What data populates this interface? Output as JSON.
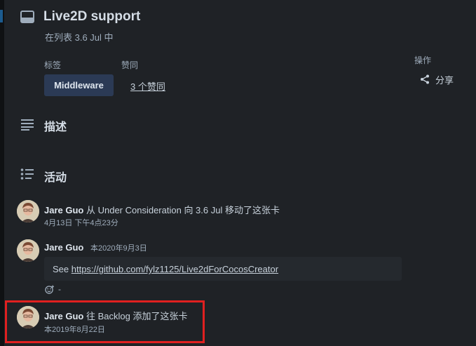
{
  "card": {
    "title": "Live2D support",
    "in_list": "在列表 3.6 Jul 中",
    "icon": "card-icon"
  },
  "labels": {
    "heading": "标签",
    "tag": "Middleware"
  },
  "votes": {
    "heading": "赞同",
    "link": "3 个赞同"
  },
  "actions": {
    "heading": "操作",
    "share": "分享",
    "share_icon": "share-icon"
  },
  "description": {
    "title": "描述",
    "icon": "description-icon"
  },
  "activity": {
    "title": "活动",
    "icon": "activity-icon",
    "items": [
      {
        "user": "Jare Guo",
        "text": "从 Under Consideration 向 3.6 Jul 移动了这张卡",
        "time": "4月13日 下午4点23分"
      },
      {
        "user": "Jare Guo",
        "time": "本2020年9月3日",
        "comment_prefix": "See ",
        "comment_link": "https://github.com/fylz1125/Live2dForCocosCreator",
        "reaction_count": "-"
      },
      {
        "user": "Jare Guo",
        "text": "往 Backlog 添加了这张卡",
        "time": "本2019年8月22日"
      }
    ]
  },
  "colors": {
    "panel": "#1f2226",
    "tag_bg": "#2b3a55",
    "highlight": "#e02020"
  }
}
